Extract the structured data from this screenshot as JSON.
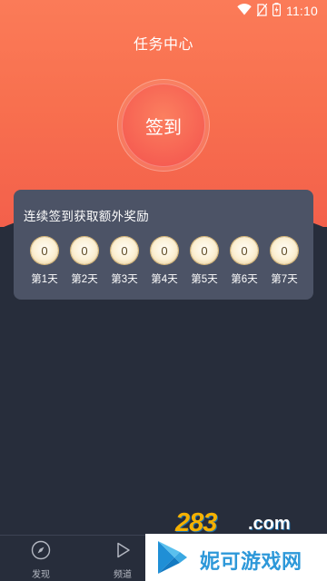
{
  "status_bar": {
    "time": "11:10",
    "icons": [
      "wifi-icon",
      "no-sim-icon",
      "battery-charging-icon"
    ]
  },
  "header": {
    "title": "任务中心"
  },
  "checkin": {
    "button_label": "签到"
  },
  "reward": {
    "title": "连续签到获取额外奖励",
    "days": [
      {
        "coin": "0",
        "label": "第1天"
      },
      {
        "coin": "0",
        "label": "第2天"
      },
      {
        "coin": "0",
        "label": "第3天"
      },
      {
        "coin": "0",
        "label": "第4天"
      },
      {
        "coin": "0",
        "label": "第5天"
      },
      {
        "coin": "0",
        "label": "第6天"
      },
      {
        "coin": "0",
        "label": "第7天"
      }
    ]
  },
  "bottom_nav": {
    "items": [
      {
        "label": "发现",
        "icon": "compass-icon"
      },
      {
        "label": "频道",
        "icon": "play-icon"
      }
    ]
  },
  "watermark": {
    "site_number": "283",
    "site_suffix": ".com",
    "brand_name": "妮可游戏网",
    "brand_color": "#2d98d9"
  },
  "colors": {
    "hero_top": "#fb7b58",
    "background": "#272d3b",
    "card": "#4c5366",
    "coin_gold": "#e6c78c"
  }
}
